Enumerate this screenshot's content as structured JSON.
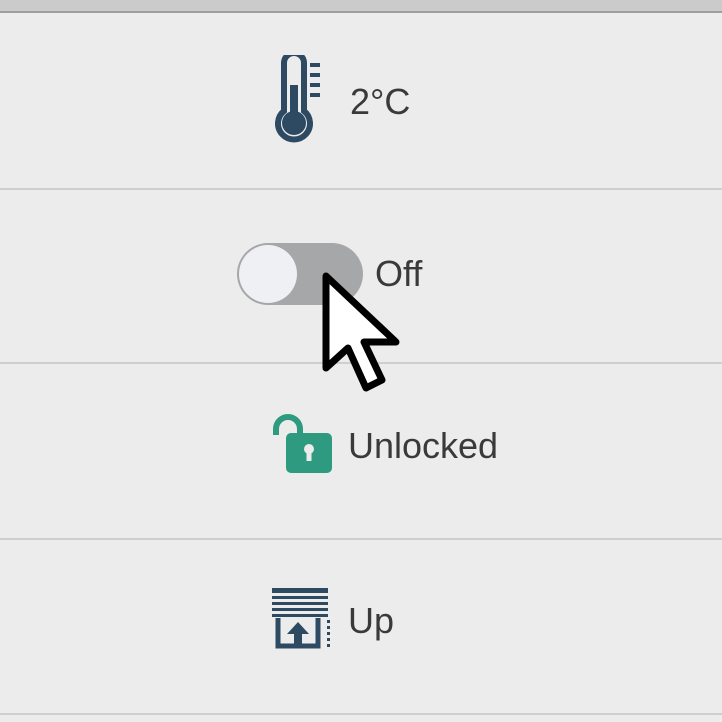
{
  "rows": {
    "temperature": {
      "icon": "thermometer-icon",
      "value": "2°C"
    },
    "switch": {
      "icon": "toggle-switch",
      "state": "Off",
      "is_on": false
    },
    "lock": {
      "icon": "unlocked-padlock-icon",
      "state": "Unlocked"
    },
    "cover": {
      "icon": "window-blind-up-icon",
      "state": "Up"
    }
  },
  "colors": {
    "background": "#ececec",
    "divider": "#cfcfcf",
    "icon_dark": "#2e4a63",
    "lock_green": "#2e9a7f",
    "toggle_off": "#a6a7a8",
    "text": "#3a3a3a"
  }
}
